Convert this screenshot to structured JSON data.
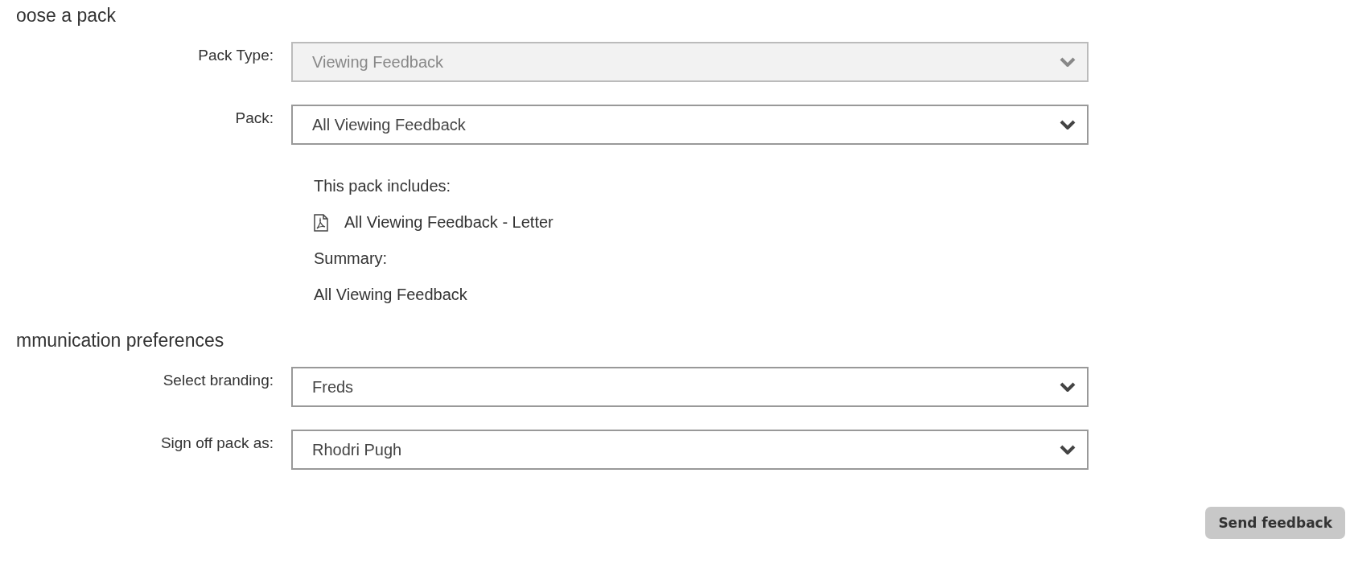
{
  "sections": [
    {
      "heading": "oose a pack",
      "fields": [
        {
          "label": "Pack Type:",
          "value": "Viewing Feedback",
          "disabled": true
        },
        {
          "label": "Pack:",
          "value": "All Viewing Feedback",
          "disabled": false
        }
      ],
      "includes": {
        "title": "This pack includes:",
        "items": [
          {
            "kind": "pdf",
            "name": "All Viewing Feedback - Letter"
          }
        ],
        "summary_label": "Summary:",
        "summary": "All Viewing Feedback"
      }
    },
    {
      "heading": "mmunication preferences",
      "fields": [
        {
          "label": "Select branding:",
          "value": "Freds",
          "disabled": false
        },
        {
          "label": "Sign off pack as:",
          "value": "Rhodri Pugh",
          "disabled": false
        }
      ]
    }
  ],
  "button": "Send feedback"
}
